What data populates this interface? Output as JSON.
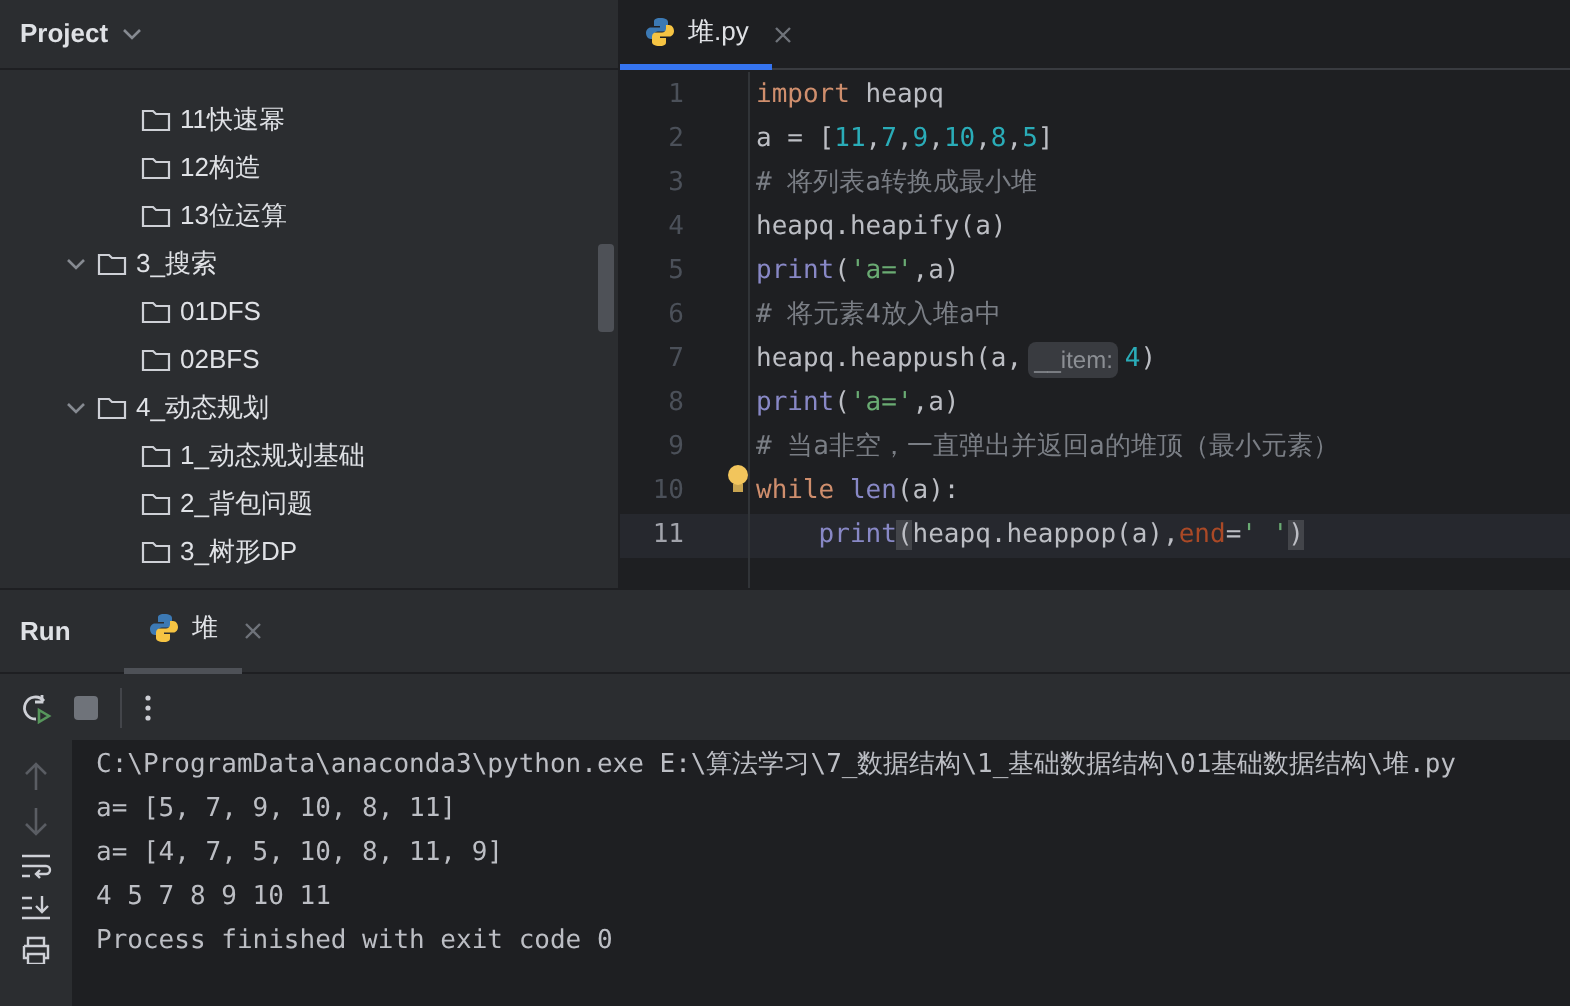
{
  "project_panel": {
    "title": "Project",
    "continued_items": [
      {
        "label": "11快速幂"
      },
      {
        "label": "12构造"
      },
      {
        "label": "13位运算"
      }
    ],
    "folders": [
      {
        "label": "3_搜索",
        "expanded": true,
        "children": [
          {
            "label": "01DFS"
          },
          {
            "label": "02BFS"
          }
        ]
      },
      {
        "label": "4_动态规划",
        "expanded": true,
        "children": [
          {
            "label": "1_动态规划基础"
          },
          {
            "label": "2_背包问题"
          },
          {
            "label": "3_树形DP"
          }
        ]
      }
    ]
  },
  "editor": {
    "tabs": [
      {
        "label": "堆.py",
        "selected": true
      }
    ],
    "lines": [
      {
        "number": "1",
        "current": false,
        "tokens": [
          {
            "kind": "keyword",
            "text": "import"
          },
          {
            "kind": "plain",
            "text": " heapq"
          }
        ]
      },
      {
        "number": "2",
        "current": false,
        "tokens": [
          {
            "kind": "plain",
            "text": "a = ["
          },
          {
            "kind": "number",
            "text": "11"
          },
          {
            "kind": "plain",
            "text": ","
          },
          {
            "kind": "number",
            "text": "7"
          },
          {
            "kind": "plain",
            "text": ","
          },
          {
            "kind": "number",
            "text": "9"
          },
          {
            "kind": "plain",
            "text": ","
          },
          {
            "kind": "number",
            "text": "10"
          },
          {
            "kind": "plain",
            "text": ","
          },
          {
            "kind": "number",
            "text": "8"
          },
          {
            "kind": "plain",
            "text": ","
          },
          {
            "kind": "number",
            "text": "5"
          },
          {
            "kind": "plain",
            "text": "]"
          }
        ]
      },
      {
        "number": "3",
        "current": false,
        "tokens": [
          {
            "kind": "comment",
            "text": "# 将列表a转换成最小堆"
          }
        ]
      },
      {
        "number": "4",
        "current": false,
        "tokens": [
          {
            "kind": "plain",
            "text": "heapq.heapify(a)"
          }
        ]
      },
      {
        "number": "5",
        "current": false,
        "tokens": [
          {
            "kind": "builtin",
            "text": "print"
          },
          {
            "kind": "plain",
            "text": "("
          },
          {
            "kind": "string",
            "text": "'a='"
          },
          {
            "kind": "plain",
            "text": ",a)"
          }
        ]
      },
      {
        "number": "6",
        "current": false,
        "tokens": [
          {
            "kind": "comment",
            "text": "# 将元素4放入堆a中"
          }
        ]
      },
      {
        "number": "7",
        "current": false,
        "tokens": [
          {
            "kind": "plain",
            "text": "heapq.heappush(a,"
          },
          {
            "kind": "hint",
            "text": "__item:"
          },
          {
            "kind": "number",
            "text": "4"
          },
          {
            "kind": "plain",
            "text": ")"
          }
        ]
      },
      {
        "number": "8",
        "current": false,
        "tokens": [
          {
            "kind": "builtin",
            "text": "print"
          },
          {
            "kind": "plain",
            "text": "("
          },
          {
            "kind": "string",
            "text": "'a='"
          },
          {
            "kind": "plain",
            "text": ",a)"
          }
        ]
      },
      {
        "number": "9",
        "current": false,
        "tokens": [
          {
            "kind": "comment",
            "text": "# 当a非空，一直弹出并返回a的堆顶（最小元素）"
          }
        ]
      },
      {
        "number": "10",
        "current": false,
        "tokens": [
          {
            "kind": "keyword",
            "text": "while"
          },
          {
            "kind": "builtin",
            "text": " len"
          },
          {
            "kind": "plain",
            "text": "(a):"
          }
        ]
      },
      {
        "number": "11",
        "current": true,
        "tokens": [
          {
            "kind": "builtin",
            "text": "    print"
          },
          {
            "kind": "match",
            "text": "("
          },
          {
            "kind": "plain",
            "text": "heapq.heappop(a),"
          },
          {
            "kind": "param",
            "text": "end"
          },
          {
            "kind": "plain",
            "text": "="
          },
          {
            "kind": "string",
            "text": "' '"
          },
          {
            "kind": "match",
            "text": ")"
          }
        ]
      }
    ]
  },
  "run_panel": {
    "title": "Run",
    "tabs": [
      {
        "label": "堆",
        "selected": true
      }
    ],
    "console": [
      "C:\\ProgramData\\anaconda3\\python.exe E:\\算法学习\\7_数据结构\\1_基础数据结构\\01基础数据结构\\堆.py",
      "a= [5, 7, 9, 10, 8, 11]",
      "a= [4, 7, 5, 10, 8, 11, 9]",
      "4 5 7 8 9 10 11",
      "Process finished with exit code 0"
    ]
  }
}
